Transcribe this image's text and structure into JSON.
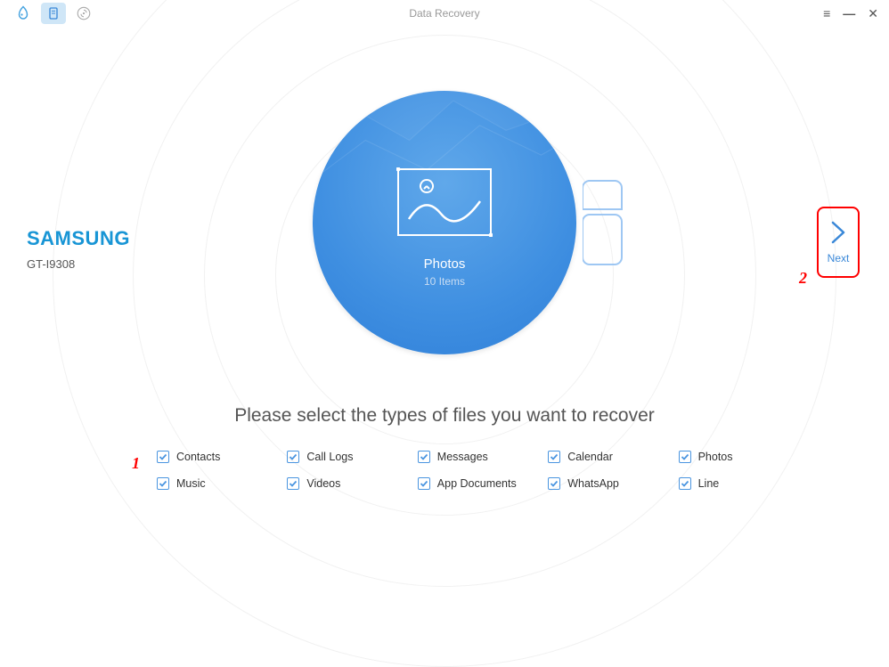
{
  "window_title": "Data Recovery",
  "device": {
    "brand": "SAMSUNG",
    "model": "GT-I9308"
  },
  "circle": {
    "title": "Photos",
    "subtitle": "10 Items"
  },
  "instruction": "Please select the types of files you want to recover",
  "next_label": "Next",
  "annotations": {
    "one": "1",
    "two": "2"
  },
  "file_types": {
    "contacts": "Contacts",
    "call_logs": "Call Logs",
    "messages": "Messages",
    "calendar": "Calendar",
    "photos": "Photos",
    "music": "Music",
    "videos": "Videos",
    "app_documents": "App Documents",
    "whatsapp": "WhatsApp",
    "line": "Line"
  }
}
